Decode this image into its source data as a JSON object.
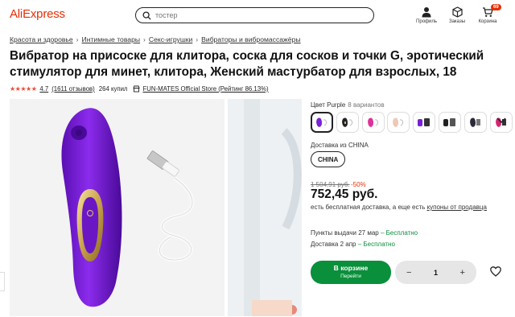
{
  "header": {
    "logo": "AliExpress",
    "search_placeholder": "тостер",
    "profile_label": "Профиль",
    "orders_label": "Заказы",
    "cart_label": "Корзина",
    "cart_count": "69"
  },
  "breadcrumbs": [
    "Красота и здоровье",
    "Интимные товары",
    "Секс-игрушки",
    "Вибраторы и вибромассажёры"
  ],
  "product": {
    "title": "Вибратор на присоске для клитора, соска для сосков и точки G, эротический стимулятор для минет, клитора, Женский мастурбатор для взрослых, 18",
    "rating_stars": "★★★★★",
    "rating": "4.7",
    "reviews": "(1611 отзывов)",
    "sold": "264 купил",
    "store": "FUN-MATES Official Store (Рейтинг 86.13%)"
  },
  "options": {
    "color_label": "Цвет Purple",
    "variants": "8 вариантов",
    "ship_from_label": "Доставка из CHINA",
    "ship_from_value": "CHINA"
  },
  "pricing": {
    "old_price": "1 504,91 руб.",
    "discount": "-50%",
    "price": "752,45 руб.",
    "free_shipping_text": "есть бесплатная доставка, а еще есть ",
    "coupons_link": "купоны от продавца"
  },
  "delivery": {
    "pickup_text": "Пункты выдачи 27 мар",
    "pickup_free": "– Бесплатно",
    "courier_text": "Доставка 2 апр",
    "courier_free": "– Бесплатно"
  },
  "actions": {
    "cart_label": "В корзине",
    "cart_sub": "Перейти",
    "minus": "−",
    "quantity": "1",
    "plus": "+"
  },
  "colors": {
    "brand": "#e62e04",
    "green": "#0a8f3b",
    "purple": "#7b1fd6"
  }
}
